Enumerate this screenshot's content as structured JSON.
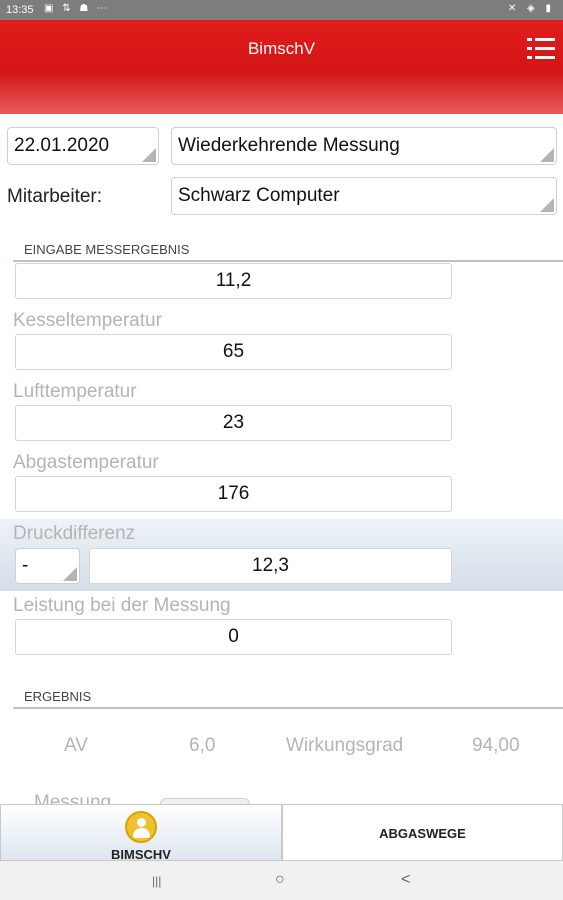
{
  "status_bar": {
    "time": "13:35",
    "left_icons": "▣ ⇅ ☗ ⋯",
    "right_icons": "✕ ◈ ▮"
  },
  "app_bar": {
    "title": "BimschV",
    "menu_icon": "menu-icon"
  },
  "date_field": {
    "value": "22.01.2020"
  },
  "type_select": {
    "value": "Wiederkehrende Messung"
  },
  "employee": {
    "label": "Mitarbeiter:",
    "value": "Schwarz Computer"
  },
  "input_section": {
    "title": "EINGABE MESSERGEBNIS",
    "first_value": "11,2",
    "fields": [
      {
        "label": "Kesseltemperatur",
        "value": "65"
      },
      {
        "label": "Lufttemperatur",
        "value": "23"
      },
      {
        "label": "Abgastemperatur",
        "value": "176"
      }
    ],
    "pressure": {
      "label": "Druckdifferenz",
      "sign": "-",
      "value": "12,3"
    },
    "power": {
      "label": "Leistung bei der Messung",
      "value": "0"
    }
  },
  "result_section": {
    "title": "ERGEBNIS",
    "av_label": "AV",
    "av_value": "6,0",
    "efficiency_label": "Wirkungsgrad",
    "efficiency_value": "94,00",
    "partial_label": "Messung"
  },
  "bottom_nav": {
    "tab1": "BIMSCHV",
    "tab2": "ABGASWEGE"
  },
  "system_nav": {
    "recents": "|||",
    "home": "○",
    "back": "<"
  }
}
